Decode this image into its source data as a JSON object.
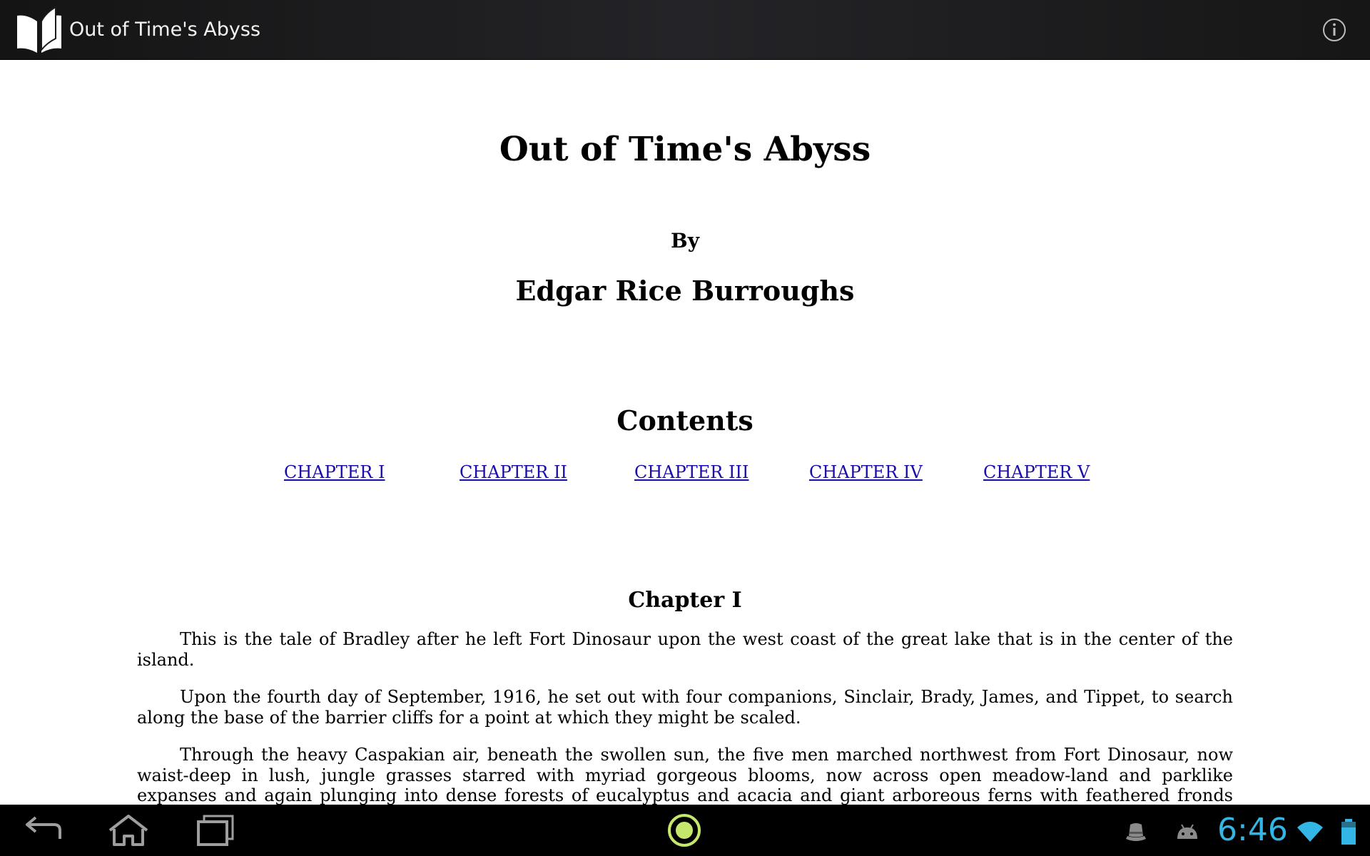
{
  "action_bar": {
    "app_title": "Out of Time's Abyss",
    "app_icon": "open-book-icon",
    "info_icon": "info-icon"
  },
  "book": {
    "title": "Out of Time's Abyss",
    "by_label": "By",
    "author": "Edgar Rice Burroughs",
    "contents_heading": "Contents",
    "toc": [
      {
        "label": "CHAPTER I"
      },
      {
        "label": "CHAPTER II"
      },
      {
        "label": "CHAPTER III"
      },
      {
        "label": "CHAPTER IV"
      },
      {
        "label": "CHAPTER V"
      }
    ],
    "chapter_heading": "Chapter I",
    "paragraphs": [
      "This is the tale of Bradley after he left Fort Dinosaur upon the west coast of the great lake that is in the center of the island.",
      "Upon the fourth day of September, 1916, he set out with four companions, Sinclair, Brady, James, and Tippet, to search along the base of the barrier cliffs for a point at which they might be scaled.",
      "Through the heavy Caspakian air, beneath the swollen sun, the five men marched northwest from Fort Dinosaur, now waist-deep in lush, jungle grasses starred with myriad gorgeous blooms, now across open meadow-land and parklike expanses and again plunging into dense forests of eucalyptus and acacia and giant arboreous ferns with feathered fronds waving gently a hundred feet above their heads."
    ],
    "link_color": "#1a0dab"
  },
  "system_bar": {
    "clock": "6:46",
    "clock_color": "#33b5e5",
    "nav_icons": [
      "back-icon",
      "home-icon",
      "recent-apps-icon"
    ],
    "center_icon": "launcher-ring-icon",
    "status_icons": [
      "hat-notification-icon",
      "android-debug-icon",
      "wifi-icon",
      "battery-icon"
    ]
  }
}
